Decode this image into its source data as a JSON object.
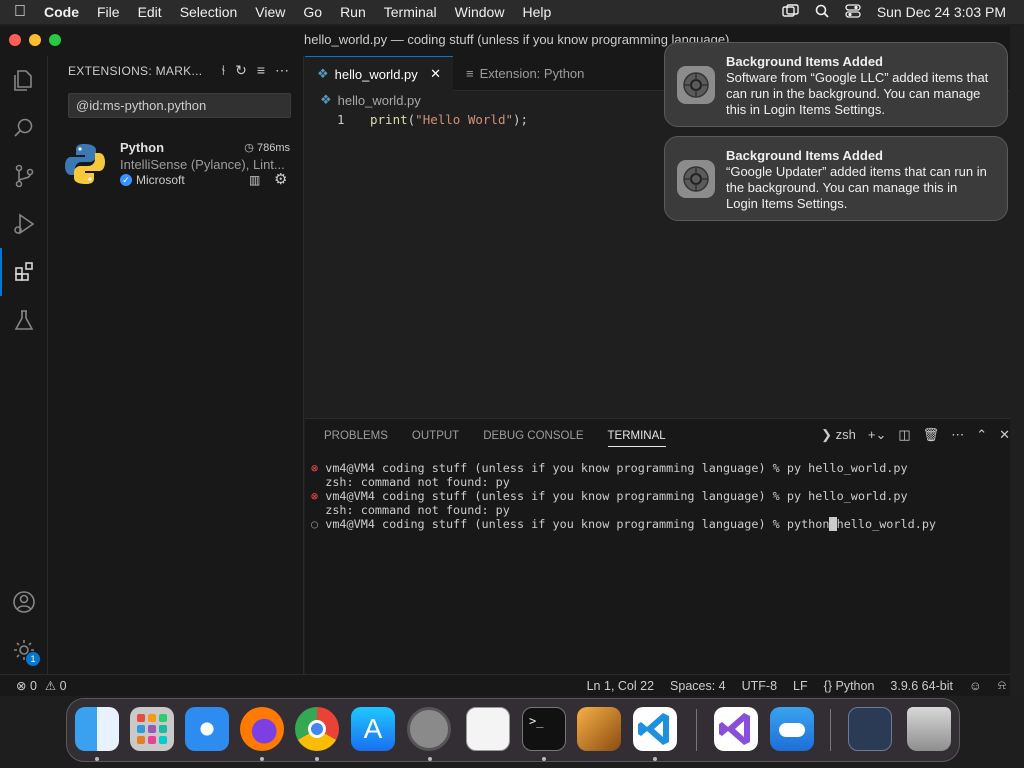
{
  "menubar": {
    "app": "Code",
    "items": [
      "File",
      "Edit",
      "Selection",
      "View",
      "Go",
      "Run",
      "Terminal",
      "Window",
      "Help"
    ],
    "datetime": "Sun Dec 24  3:03 PM"
  },
  "window": {
    "title": "hello_world.py — coding stuff (unless if you know programming language)"
  },
  "sidebar": {
    "header": "EXTENSIONS: MARK...",
    "search_value": "@id:ms-python.python",
    "extension": {
      "name": "Python",
      "time": "786ms",
      "description": "IntelliSense (Pylance), Lint...",
      "publisher": "Microsoft"
    }
  },
  "activity": {
    "badge": "1"
  },
  "tabs": [
    {
      "label": "hello_world.py"
    },
    {
      "label": "Extension: Python"
    }
  ],
  "breadcrumb": "hello_world.py",
  "editor": {
    "line_number": "1",
    "code_fn": "print",
    "code_open": "(",
    "code_str": "\"Hello World\"",
    "code_close": ");"
  },
  "panel": {
    "tabs": [
      "PROBLEMS",
      "OUTPUT",
      "DEBUG CONSOLE",
      "TERMINAL"
    ],
    "shell": "zsh",
    "lines": [
      {
        "marker": "⊗",
        "text": "vm4@VM4 coding stuff (unless if you know programming language) % py hello_world.py"
      },
      {
        "marker": "",
        "text": "zsh: command not found: py"
      },
      {
        "marker": "⊗",
        "text": "vm4@VM4 coding stuff (unless if you know programming language) % py hello_world.py"
      },
      {
        "marker": "",
        "text": "zsh: command not found: py"
      },
      {
        "marker": "○",
        "text_before": "vm4@VM4 coding stuff (unless if you know programming language) % python",
        "text_after": "hello_world.py"
      }
    ]
  },
  "status": {
    "errors": "0",
    "warnings": "0",
    "position": "Ln 1, Col 22",
    "spaces": "Spaces: 4",
    "encoding": "UTF-8",
    "eol": "LF",
    "language": "Python",
    "interpreter": "3.9.6 64-bit"
  },
  "notifications": [
    {
      "title": "Background Items Added",
      "body": "Software from “Google LLC” added items that can run in the background. You can manage this in Login Items Settings."
    },
    {
      "title": "Background Items Added",
      "body": "“Google Updater” added items that can run in the background. You can manage this in Login Items Settings."
    }
  ],
  "colors": {
    "accent": "#0078d4",
    "error": "#f14c4c"
  }
}
